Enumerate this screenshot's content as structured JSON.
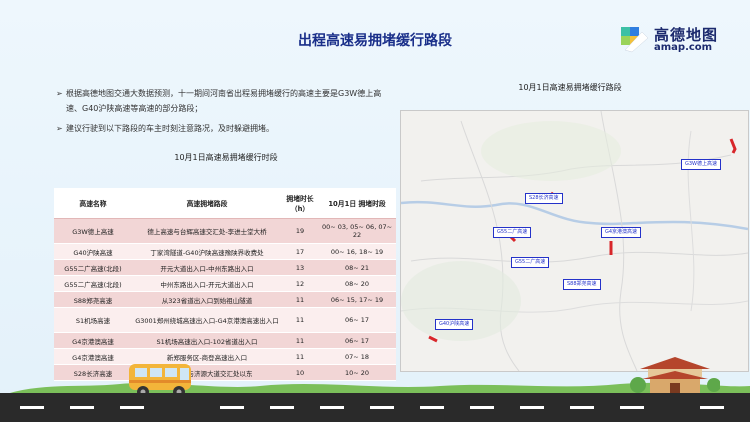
{
  "title": "出程高速易拥堵缓行路段",
  "logo": {
    "cn": "高德地图",
    "en": "amap.com"
  },
  "bullets": [
    "根据高德地图交通大数据预测，十一期间河南省出程易拥堵缓行的高速主要是G3W德上高速、G40沪陕高速等高速的部分路段；",
    "建议行驶到以下路段的车主时刻注意路况，及时躲避拥堵。"
  ],
  "table": {
    "caption": "10月1日高速易拥堵缓行时段",
    "headers": [
      "高速名称",
      "高速拥堵路段",
      "拥堵时长（h）",
      "10月1日 拥堵时段"
    ],
    "rows": [
      [
        "G3W德上高速",
        "德上高速与台辉高速交汇处-李进士堂大桥",
        "19",
        "00~ 03, 05~ 06, 07~ 22"
      ],
      [
        "G40沪陕高速",
        "丁家湾隧道-G40沪陕高速豫陕界收费处",
        "17",
        "00~ 16, 18~ 19"
      ],
      [
        "G55二广高速(北段)",
        "开元大道出入口-中州东路出入口",
        "13",
        "08~ 21"
      ],
      [
        "G55二广高速(北段)",
        "中州东路出入口-开元大道出入口",
        "12",
        "08~ 20"
      ],
      [
        "S88郑尧高速",
        "从323省道出入口到始祖山隧道",
        "11",
        "06~ 15, 17~ 19"
      ],
      [
        "S1机场高速",
        "G3001郑州绕城高速出入口-G4京港澳高速出入口",
        "11",
        "06~ 17"
      ],
      [
        "G4京港澳高速",
        "S1机场高速出入口-102省道出入口",
        "11",
        "06~ 17"
      ],
      [
        "G4京港澳高速",
        "新郑服务区-商登高速出入口",
        "11",
        "07~ 18"
      ],
      [
        "S28长济高速",
        "二广高速与济源大道交汇处以东",
        "10",
        "10~ 20"
      ]
    ]
  },
  "map": {
    "caption": "10月1日高速易拥堵缓行路段",
    "labels": [
      "G3W德上高速",
      "S28长济高速",
      "G55二广高速",
      "G4京港澳高速",
      "G55二广高速",
      "S88郑尧高速",
      "G40沪陕高速"
    ],
    "accent": "#2432c9",
    "congestion_color": "#d8262a"
  },
  "colors": {
    "title": "#1a2f8a",
    "row_odd": "#f2d6d6",
    "row_even": "#fbeeee"
  }
}
